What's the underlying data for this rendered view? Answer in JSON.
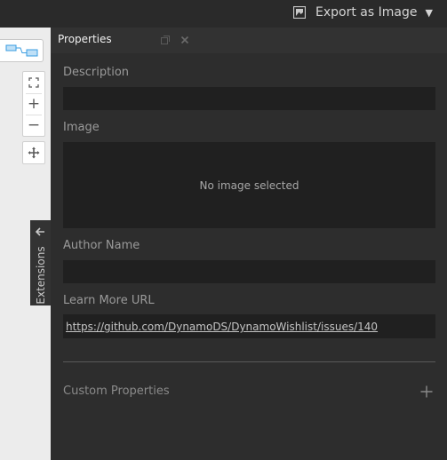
{
  "toolbar": {
    "export_label": "Export as Image",
    "export_icon": "image-export-icon",
    "caret_glyph": "▼"
  },
  "canvas": {
    "background": "#ffffff",
    "graph_button_icon": "node-graph-icon",
    "zoom_in_glyph": "+",
    "zoom_out_glyph": "−",
    "fit_icon": "fit-view-icon",
    "pan_icon": "pan-icon"
  },
  "extensions_tab": {
    "label": "Extensions",
    "arrow_icon": "arrow-left-icon"
  },
  "properties": {
    "title": "Properties",
    "description_label": "Description",
    "description_value": "",
    "image_label": "Image",
    "image_placeholder": "No image selected",
    "author_label": "Author Name",
    "author_value": "",
    "url_label": "Learn More URL",
    "url_value": "https://github.com/DynamoDS/DynamoWishlist/issues/140",
    "custom_label": "Custom Properties"
  },
  "colors": {
    "panel_bg": "#2d2d2d",
    "field_bg": "#202020",
    "label": "#9a9a9a",
    "accent_node": "#3a9de0"
  }
}
